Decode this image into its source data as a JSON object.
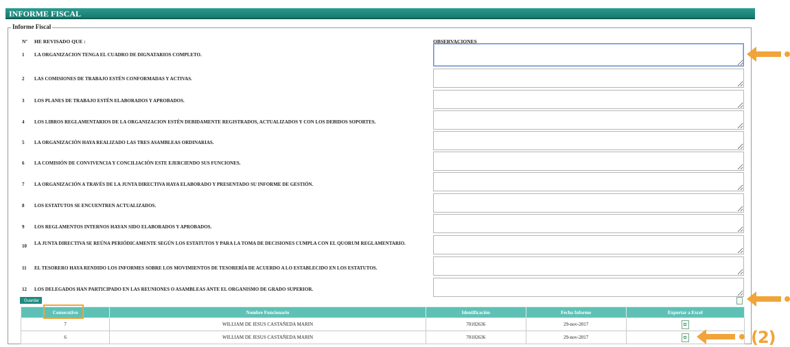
{
  "title": "INFORME FISCAL",
  "legend": "Informe Fiscal",
  "header": {
    "num_label": "Nº",
    "reviewed_label": "HE REVISADO QUE :",
    "observations_label": "OBSERVACIONES"
  },
  "items": [
    {
      "num": "1",
      "text": "LA ORGANIZACION TENGA EL CUADRO DE DIGNATARIOS COMPLETO."
    },
    {
      "num": "2",
      "text": "LAS COMISIONES DE TRABAJO ESTÉN CONFORMADAS Y ACTIVAS."
    },
    {
      "num": "3",
      "text": "LOS PLANES DE TRABAJO ESTÉN ELABORADOS Y APROBADOS."
    },
    {
      "num": "4",
      "text": "LOS LIBROS REGLAMENTARIOS DE LA ORGANIZACION ESTÉN DEBIDAMENTE REGISTRADOS, ACTUALIZADOS Y CON LOS DEBIDOS SOPORTES."
    },
    {
      "num": "5",
      "text": "LA ORGANIZACIÓN HAYA REALIZADO LAS TRES ASAMBLEAS ORDINARIAS."
    },
    {
      "num": "6",
      "text": "LA COMISIÓN DE CONVIVENCIA Y CONCILIACIÓN ESTE EJERCIENDO SUS FUNCIONES."
    },
    {
      "num": "7",
      "text": "LA ORGANIZACIÓN A TRAVÉS DE LA JUNTA DIRECTIVA HAYA ELABORADO Y PRESENTADO SU INFORME DE GESTIÓN."
    },
    {
      "num": "8",
      "text": "LOS ESTATUTOS SE ENCUENTREN ACTUALIZADOS."
    },
    {
      "num": "9",
      "text": "LOS REGLAMENTOS INTERNOS HAYAN SIDO ELABORADOS Y APROBADOS."
    },
    {
      "num": "10",
      "text": "LA JUNTA DIRECTIVA SE REÚNA PERIÓDICAMENTE SEGÚN LOS ESTATUTOS Y PARA LA TOMA DE DECISIONES CUMPLA CON EL QUORUM REGLAMENTARIO."
    },
    {
      "num": "11",
      "text": "EL TESORERO HAYA RENDIDO LOS INFORMES SOBRE LOS MOVIMIENTOS DE TESORERÍA DE ACUERDO A LO ESTABLECIDO EN LOS ESTATUTOS."
    },
    {
      "num": "12",
      "text": "LOS DELEGADOS HAN PARTICIPADO EN LAS REUNIONES O ASAMBLEAS ANTE EL ORGANISMO DE GRADO SUPERIOR."
    }
  ],
  "save_button": "Guardar",
  "table": {
    "columns": [
      "Consecutivo",
      "Nombre Funcionario",
      "Identificación",
      "Fecha Informe",
      "Exportar a Excel"
    ],
    "rows": [
      {
        "consecutivo": "7",
        "nombre": "WILLIAM DE JESUS CASTAÑEDA MARIN",
        "identificacion": "70102636",
        "fecha": "29-nov-2017"
      },
      {
        "consecutivo": "6",
        "nombre": "WILLIAM DE JESUS CASTAÑEDA MARIN",
        "identificacion": "70102636",
        "fecha": "29-nov-2017"
      }
    ]
  },
  "annotations": {
    "callout_2": "(2)",
    "accent_color": "#f0a43a"
  },
  "colors": {
    "title_bar": "#177a70",
    "table_header": "#5fc1b6"
  }
}
